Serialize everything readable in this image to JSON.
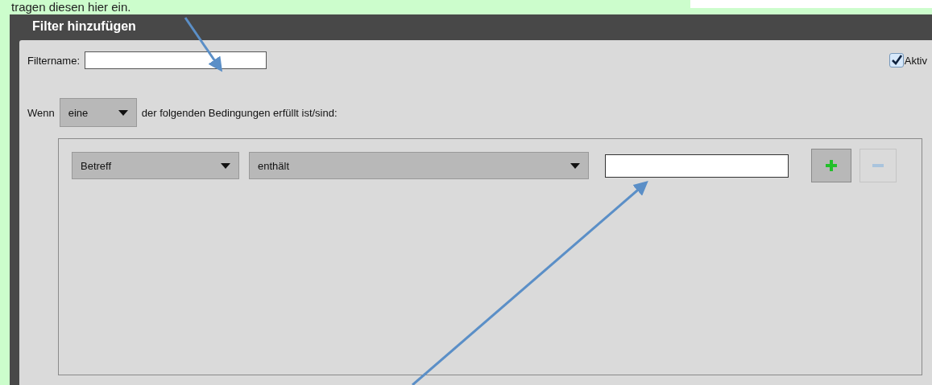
{
  "caption": "tragen diesen hier ein.",
  "dialog": {
    "title": "Filter hinzufügen",
    "filtername": {
      "label": "Filtername:"
    },
    "active": {
      "label": "Aktiv",
      "checked": true
    },
    "match": {
      "prefix": "Wenn",
      "select": "eine",
      "suffix": "der folgenden Bedingungen erfüllt ist/sind:"
    },
    "conditions": [
      {
        "field": "Betreff",
        "operator": "enthält",
        "add_disabled": false,
        "remove_disabled": true
      }
    ]
  }
}
